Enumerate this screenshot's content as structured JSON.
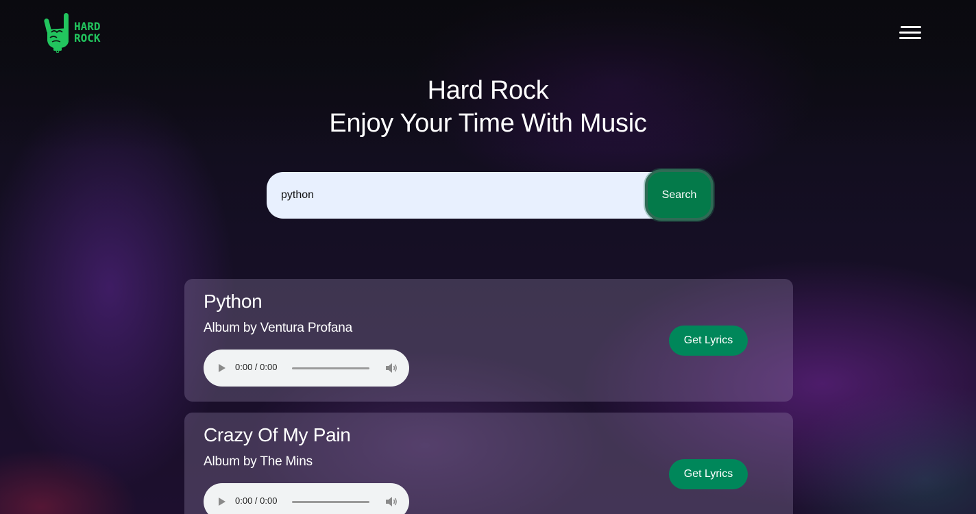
{
  "brand": {
    "logo_line1": "HARD",
    "logo_line2": "ROCK",
    "accent_color": "#22c55e"
  },
  "nav": {
    "menu_icon": "hamburger-menu-icon"
  },
  "hero": {
    "title": "Hard Rock",
    "subtitle": "Enjoy Your Time With Music"
  },
  "search": {
    "value": "python",
    "button_label": "Search",
    "button_color": "#047a4a"
  },
  "songs": [
    {
      "title": "Python",
      "artist": "Album by Ventura Profana",
      "time": "0:00 / 0:00",
      "progress": 0,
      "lyrics_label": "Get Lyrics"
    },
    {
      "title": "Crazy Of My Pain",
      "artist": "Album by The Mins",
      "time": "0:00 / 0:00",
      "progress": 0,
      "lyrics_label": "Get Lyrics"
    }
  ]
}
